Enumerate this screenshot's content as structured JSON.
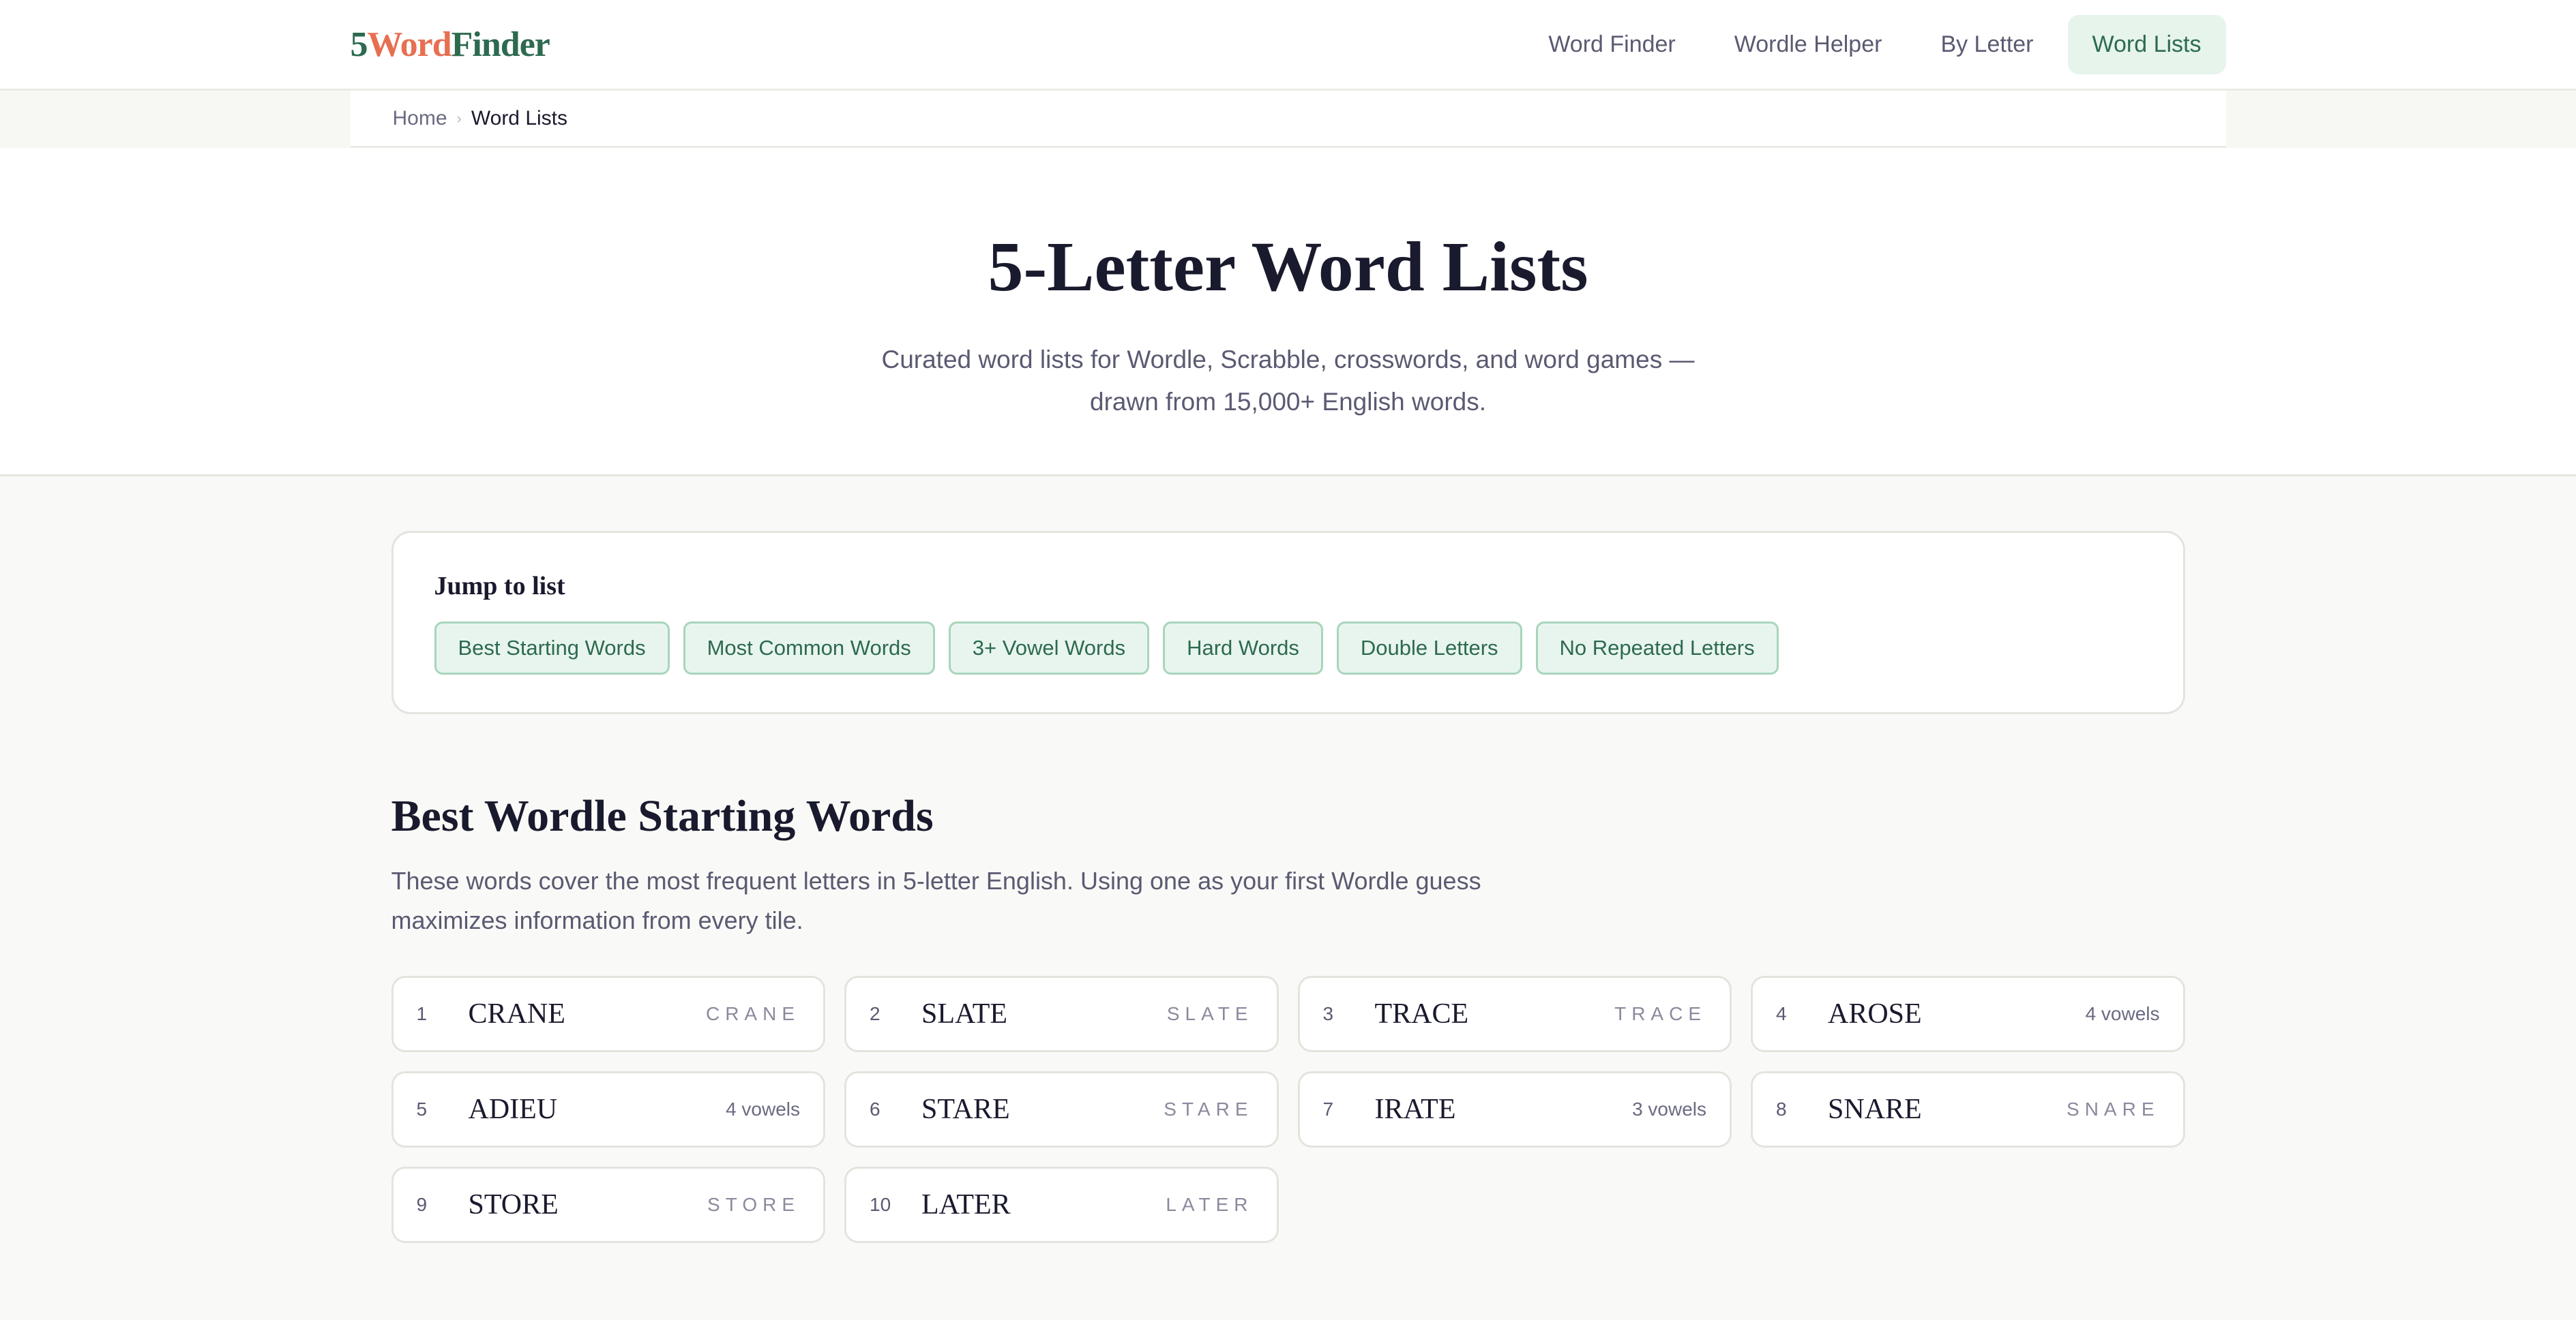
{
  "logo": {
    "part1": "5",
    "part2": "Word",
    "part3": "Finder"
  },
  "nav": [
    {
      "label": "Word Finder"
    },
    {
      "label": "Wordle Helper"
    },
    {
      "label": "By Letter"
    },
    {
      "label": "Word Lists",
      "active": true
    }
  ],
  "breadcrumb": {
    "home": "Home",
    "separator": "›",
    "current": "Word Lists"
  },
  "hero": {
    "title": "5-Letter Word Lists",
    "subtitle": "Curated word lists for Wordle, Scrabble, crosswords, and word games — drawn from 15,000+ English words."
  },
  "jump": {
    "title": "Jump to list",
    "chips": [
      "Best Starting Words",
      "Most Common Words",
      "3+ Vowel Words",
      "Hard Words",
      "Double Letters",
      "No Repeated Letters"
    ]
  },
  "section": {
    "title": "Best Wordle Starting Words",
    "description": "These words cover the most frequent letters in 5-letter English. Using one as your first Wordle guess maximizes information from every tile.",
    "cards": [
      {
        "num": "1",
        "word": "CRANE",
        "meta": "CRANE",
        "spaced": true
      },
      {
        "num": "2",
        "word": "SLATE",
        "meta": "SLATE",
        "spaced": true
      },
      {
        "num": "3",
        "word": "TRACE",
        "meta": "TRACE",
        "spaced": true
      },
      {
        "num": "4",
        "word": "AROSE",
        "meta": "4 vowels",
        "spaced": false
      },
      {
        "num": "5",
        "word": "ADIEU",
        "meta": "4 vowels",
        "spaced": false
      },
      {
        "num": "6",
        "word": "STARE",
        "meta": "STARE",
        "spaced": true
      },
      {
        "num": "7",
        "word": "IRATE",
        "meta": "3 vowels",
        "spaced": false
      },
      {
        "num": "8",
        "word": "SNARE",
        "meta": "SNARE",
        "spaced": true
      },
      {
        "num": "9",
        "word": "STORE",
        "meta": "STORE",
        "spaced": true
      },
      {
        "num": "10",
        "word": "LATER",
        "meta": "LATER",
        "spaced": true
      }
    ]
  }
}
